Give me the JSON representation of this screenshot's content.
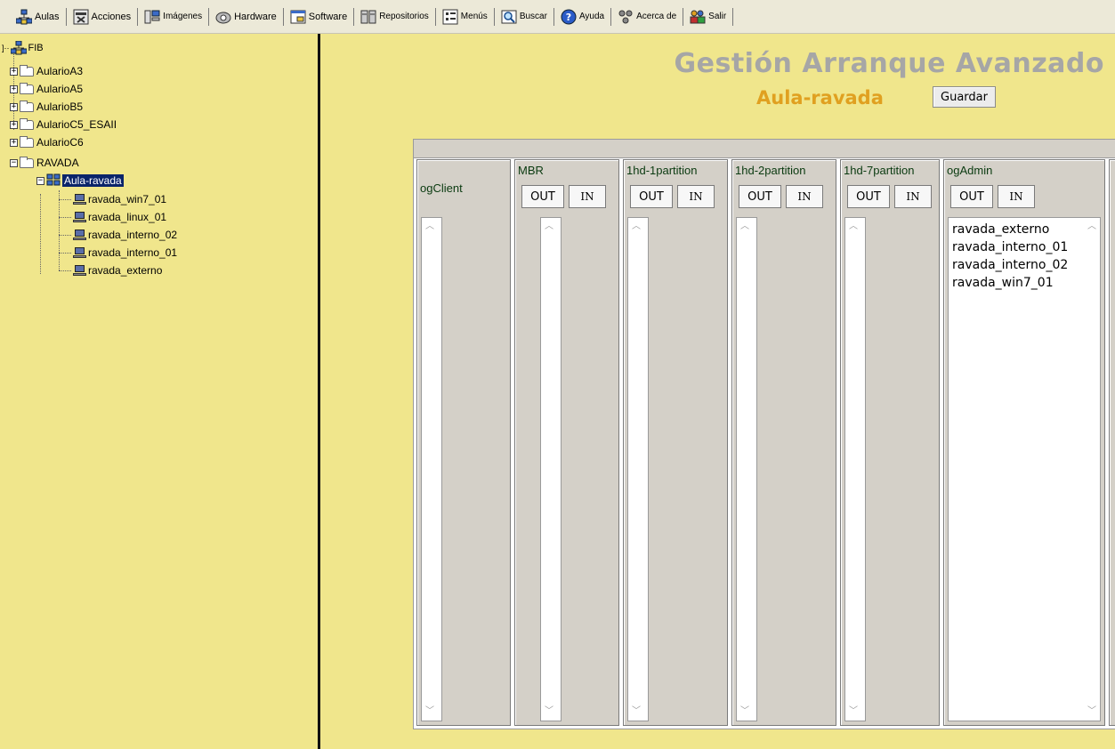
{
  "toolbar": {
    "items": [
      {
        "label": "Aulas",
        "icon": "network-icon"
      },
      {
        "label": "Acciones",
        "icon": "actions-icon"
      },
      {
        "label": "Imágenes",
        "icon": "images-icon"
      },
      {
        "label": "Hardware",
        "icon": "hardware-icon"
      },
      {
        "label": "Software",
        "icon": "software-icon"
      },
      {
        "label": "Repositorios",
        "icon": "repository-icon"
      },
      {
        "label": "Menús",
        "icon": "menu-icon"
      },
      {
        "label": "Buscar",
        "icon": "search-icon"
      },
      {
        "label": "Ayuda",
        "icon": "help-icon"
      },
      {
        "label": "Acerca de",
        "icon": "about-icon"
      },
      {
        "label": "Salir",
        "icon": "exit-icon"
      }
    ]
  },
  "tree": {
    "root": "FIB",
    "folders": [
      "AularioA3",
      "AularioA5",
      "AularioB5",
      "AularioC5_ESAII",
      "AularioC6",
      "RAVADA"
    ],
    "selected": "Aula-ravada",
    "computers": [
      "ravada_win7_01",
      "ravada_linux_01",
      "ravada_interno_02",
      "ravada_interno_01",
      "ravada_externo"
    ]
  },
  "main": {
    "title": "Gestión Arranque Avanzado",
    "aula": "Aula-ravada",
    "save_label": "Guardar",
    "out_label": "OUT",
    "in_label": "IN",
    "columns": [
      {
        "title": "ogClient",
        "items": []
      },
      {
        "title": "MBR",
        "items": []
      },
      {
        "title": "1hd-1partition",
        "items": []
      },
      {
        "title": "1hd-2partition",
        "items": []
      },
      {
        "title": "1hd-7partition",
        "items": []
      },
      {
        "title": "ogAdmin",
        "items": [
          "ravada_externo",
          "ravada_interno_01",
          "ravada_interno_02",
          "ravada_win7_01"
        ]
      }
    ]
  },
  "colors": {
    "background": "#f0e68c",
    "title_gray": "#a6a6a6",
    "aula_orange": "#e0a020",
    "selection": "#0a246a"
  }
}
